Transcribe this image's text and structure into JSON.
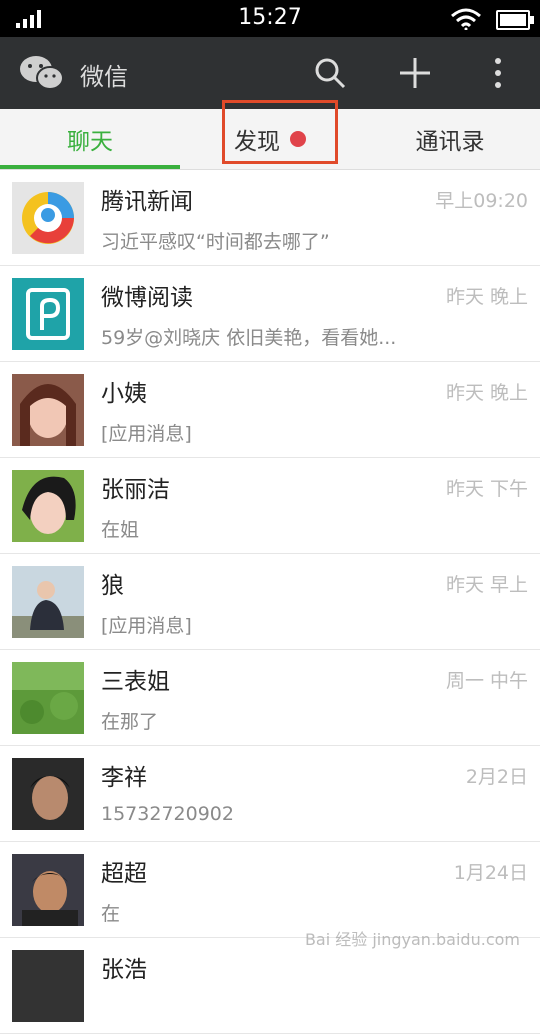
{
  "status_bar": {
    "time": "15:27"
  },
  "app_bar": {
    "title": "微信",
    "actions": [
      "search-icon",
      "plus-icon",
      "more-icon"
    ]
  },
  "tabs": [
    {
      "label": "聊天",
      "active": true
    },
    {
      "label": "发现",
      "badge": "red-dot"
    },
    {
      "label": "通讯录"
    }
  ],
  "chats": [
    {
      "name": "腾讯新闻",
      "preview": "习近平感叹“时间都去哪了”",
      "time": "早上09:20"
    },
    {
      "name": "微博阅读",
      "preview": "59岁@刘晓庆 依旧美艳，看看她...",
      "time": "昨天 晚上"
    },
    {
      "name": "小姨",
      "preview": "[应用消息]",
      "time": "昨天 晚上"
    },
    {
      "name": "张丽洁",
      "preview": "在姐",
      "time": "昨天 下午"
    },
    {
      "name": "狼",
      "preview": "[应用消息]",
      "time": "昨天 早上"
    },
    {
      "name": "三表姐",
      "preview": "在那了",
      "time": "周一 中午"
    },
    {
      "name": "李祥",
      "preview": "15732720902",
      "time": "2月2日"
    },
    {
      "name": "超超",
      "preview": "在",
      "time": "1月24日"
    },
    {
      "name": "张浩",
      "preview": "",
      "time": ""
    }
  ],
  "watermark": "Bai 经验 jingyan.baidu.com",
  "colors": {
    "accent": "#3ab03e",
    "appbar": "#2f3133",
    "highlight": "#e04a2a",
    "dot": "#e0434a"
  }
}
